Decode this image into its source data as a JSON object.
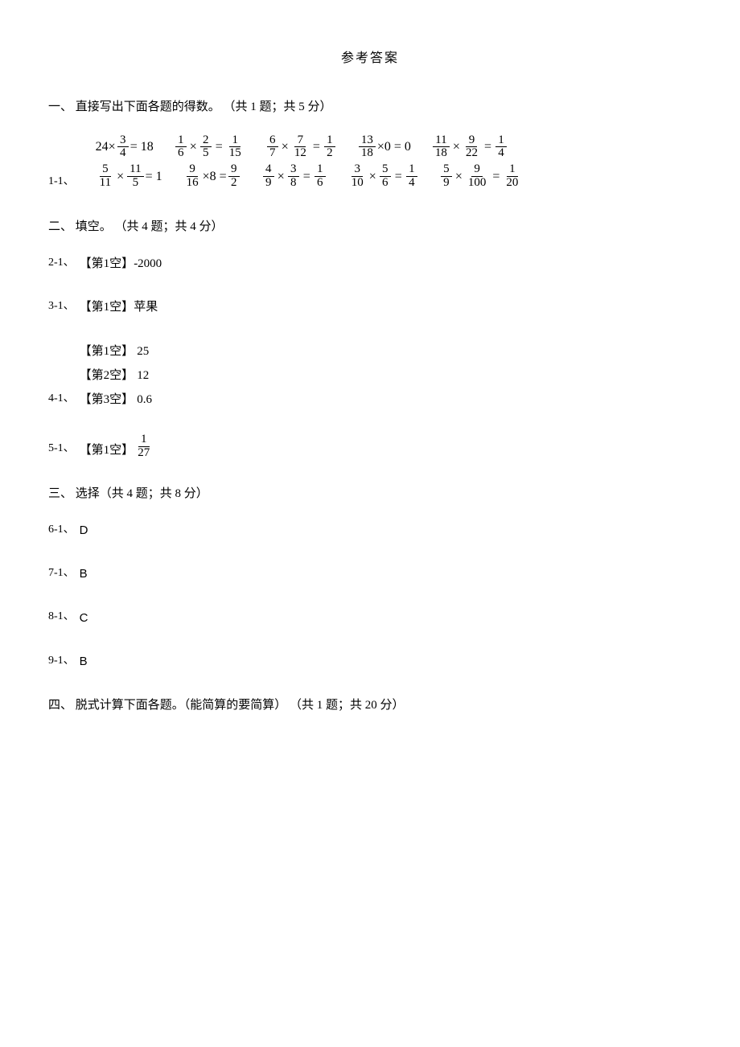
{
  "title": "参考答案",
  "sections": {
    "s1": "一、 直接写出下面各题的得数。 （共 1 题；共 5 分）",
    "s2": "二、 填空。 （共 4 题；共 4 分）",
    "s3": "三、 选择（共 4 题；共 8 分）",
    "s4": "四、 脱式计算下面各题。（能简算的要简算） （共 1 题；共 20 分）"
  },
  "q1": {
    "label": "1-1、",
    "row1": [
      {
        "lhs_int": "24×",
        "f1n": "3",
        "f1d": "4",
        "rhs": " = 18"
      },
      {
        "f1n": "1",
        "f1d": "6",
        "op": " × ",
        "f2n": "2",
        "f2d": "5",
        "eq": " = ",
        "rn": "1",
        "rd": "15"
      },
      {
        "f1n": "6",
        "f1d": "7",
        "op": " × ",
        "f2n": "7",
        "f2d": "12",
        "eq": " = ",
        "rn": "1",
        "rd": "2"
      },
      {
        "f1n": "13",
        "f1d": "18",
        "rhs": " ×0 = 0"
      },
      {
        "f1n": "11",
        "f1d": "18",
        "op": " × ",
        "f2n": "9",
        "f2d": "22",
        "eq": " = ",
        "rn": "1",
        "rd": "4"
      }
    ],
    "row2": [
      {
        "f1n": "5",
        "f1d": "11",
        "op": " × ",
        "f2n": "11",
        "f2d": "5",
        "rhs": " = 1"
      },
      {
        "f1n": "9",
        "f1d": "16",
        "mid": " ×8 = ",
        "rn": "9",
        "rd": "2"
      },
      {
        "f1n": "4",
        "f1d": "9",
        "op": " × ",
        "f2n": "3",
        "f2d": "8",
        "eq": " = ",
        "rn": "1",
        "rd": "6"
      },
      {
        "f1n": "3",
        "f1d": "10",
        "op": " × ",
        "f2n": "5",
        "f2d": "6",
        "eq": " = ",
        "rn": "1",
        "rd": "4"
      },
      {
        "f1n": "5",
        "f1d": "9",
        "op": " × ",
        "f2n": "9",
        "f2d": "100",
        "eq": " = ",
        "rn": "1",
        "rd": "20"
      }
    ]
  },
  "answers": {
    "q2": {
      "label": "2-1、",
      "blank": "【第1空】",
      "val": "-2000"
    },
    "q3": {
      "label": "3-1、",
      "blank": "【第1空】",
      "val": "苹果"
    },
    "q4": {
      "label": "4-1、",
      "lines": [
        {
          "blank": "【第1空】",
          "val": "25"
        },
        {
          "blank": "【第2空】",
          "val": "12"
        },
        {
          "blank": "【第3空】",
          "val": "0.6"
        }
      ]
    },
    "q5": {
      "label": "5-1、",
      "blank": "【第1空】",
      "fn": "1",
      "fd": "27"
    },
    "q6": {
      "label": "6-1、",
      "val": "D"
    },
    "q7": {
      "label": "7-1、",
      "val": "B"
    },
    "q8": {
      "label": "8-1、",
      "val": "C"
    },
    "q9": {
      "label": "9-1、",
      "val": "B"
    }
  }
}
